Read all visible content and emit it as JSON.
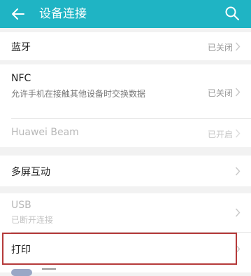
{
  "header": {
    "title": "设备连接",
    "back_icon": "arrow-left-icon",
    "search_icon": "search-icon",
    "color": "#1fb4c4"
  },
  "settings": {
    "bluetooth": {
      "label": "蓝牙",
      "value": "已关闭"
    },
    "nfc": {
      "label": "NFC",
      "desc": "允许手机在接触其他设备时交换数据",
      "value": "已关闭"
    },
    "huawei_beam": {
      "label": "Huawei Beam",
      "value": "已开启"
    },
    "multi_screen": {
      "label": "多屏互动"
    },
    "usb": {
      "label": "USB",
      "desc": "已断开连接"
    },
    "print": {
      "label": "打印"
    }
  }
}
